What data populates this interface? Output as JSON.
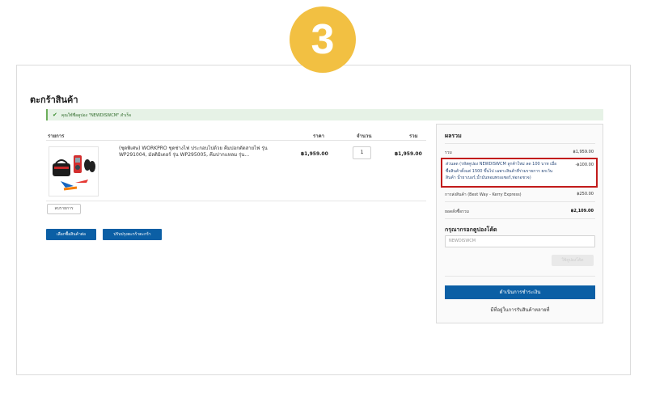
{
  "step": {
    "number": "3"
  },
  "page": {
    "title": "ตะกร้าสินค้า"
  },
  "notice": {
    "text": "คุณใช้ชื่อคูปอง \"NEWDISWCM\" สำเร็จ"
  },
  "cart": {
    "headers": {
      "item": "รายการ",
      "price": "ราคา",
      "qty": "จำนวน",
      "total": "รวม"
    },
    "items": [
      {
        "name": "(ชุดพิเศษ) WORKPRO ชุดช่างไฟ ประกอบไปด้วย คีมปอกตัดสายไฟ รุ่น WP291004, มัลติมิเตอร์ รุ่น WP295005, คีมปากแหลม รุ่น...",
        "price": "฿1,959.00",
        "qty": "1",
        "total": "฿1,959.00"
      }
    ],
    "remove_label": "ลบรายการ",
    "continue_label": "เลือกซื้อสินค้าต่อ",
    "update_label": "ปรับปรุงตะกร้าตะกร้า"
  },
  "summary": {
    "title": "ผลรวม",
    "subtotal_label": "รวม",
    "subtotal_value": "฿1,959.00",
    "discount_label": "ส่วนลด (รหัสคูปอง NEWDISWCM ลูกค้าใหม่ ลด 100 บาท เมื่อซื้อสินค้าตั้งแต่ 1500 ขึ้นไป เฉพาะสินค้าที่ร่วมรายการ ยกเว้นสินค้า น้ำยาเบอร์,น้ำมันหอมพรอเซอร์,ท่อกอชวจ)",
    "discount_value": "-฿100.00",
    "shipping_label": "การส่งสินค้า (Best Way - Kerry Express)",
    "shipping_value": "฿250.00",
    "total_label": "ยอดสั่งซื้อรวม",
    "total_value": "฿2,109.00",
    "coupon_title": "กรุณากรอกคูปองโค้ด",
    "coupon_value": "NEWDISWCM",
    "apply_label": "ใช้คูปองโค้ด",
    "checkout_label": "ดำเนินการชำระเงิน",
    "delivery_link": "มีที่อยู่ในการรับสินค้าหลายที่"
  },
  "colors": {
    "accent": "#0b5fa5",
    "badge": "#f2c042",
    "highlight": "#c21b1b",
    "notice_bg": "#e6f2e6"
  }
}
